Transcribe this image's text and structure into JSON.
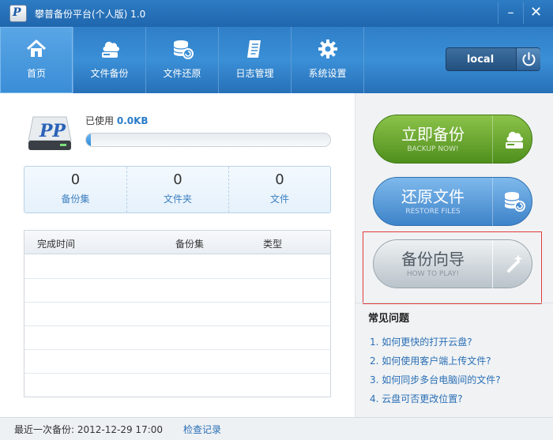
{
  "window": {
    "title": "攀普备份平台(个人版) 1.0",
    "logo_text": "P",
    "minimize_glyph": "–",
    "close_glyph": "✕"
  },
  "toolbar": {
    "items": [
      {
        "label": "首页",
        "icon": "home-icon"
      },
      {
        "label": "文件备份",
        "icon": "backup-icon"
      },
      {
        "label": "文件还原",
        "icon": "restore-icon"
      },
      {
        "label": "日志管理",
        "icon": "log-icon"
      },
      {
        "label": "系统设置",
        "icon": "settings-icon"
      }
    ],
    "active_index": 0,
    "server": {
      "name": "local",
      "power_icon": "power-icon"
    }
  },
  "usage": {
    "label_prefix": "已使用",
    "value": "0.0KB",
    "percent": 2
  },
  "stats": [
    {
      "count": "0",
      "label": "备份集"
    },
    {
      "count": "0",
      "label": "文件夹"
    },
    {
      "count": "0",
      "label": "文件"
    }
  ],
  "records": {
    "columns": [
      "完成时间",
      "备份集",
      "类型"
    ],
    "rows": []
  },
  "actions": {
    "backup": {
      "label": "立即备份",
      "sublabel": "BACKUP NOW!"
    },
    "restore": {
      "label": "还原文件",
      "sublabel": "RESTORE FILES"
    },
    "guide": {
      "label": "备份向导",
      "sublabel": "HOW TO PLAY!"
    }
  },
  "faq": {
    "title": "常见问题",
    "items": [
      "1. 如何更快的打开云盘?",
      "2. 如何使用客户端上传文件?",
      "3. 如何同步多台电脑间的文件?",
      "4. 云盘可否更改位置?"
    ]
  },
  "status": {
    "last_backup_label": "最近一次备份:",
    "last_backup_time": "2012-12-29 17:00",
    "check_records_link": "检查记录"
  },
  "colors": {
    "title_blue": "#1f66ad",
    "backup_green": "#5e9e24",
    "restore_blue": "#4a8fd3",
    "highlight_red": "#e23b3b",
    "link_blue": "#2a6fb5"
  }
}
